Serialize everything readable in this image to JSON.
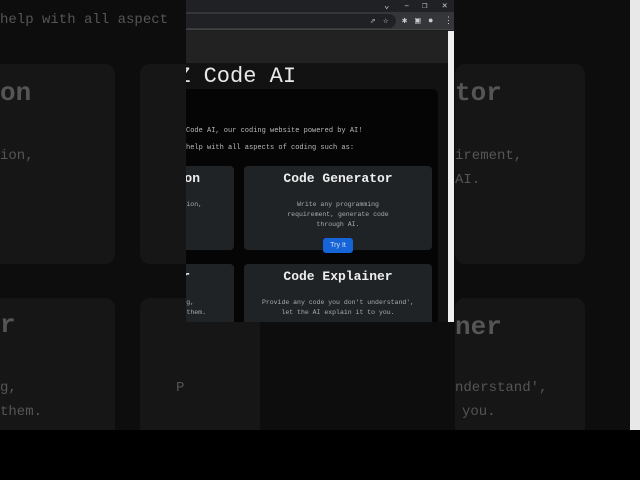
{
  "background": {
    "top_text": "help with all aspect",
    "left": [
      "on",
      "ion,",
      "r",
      "g,",
      "them."
    ],
    "right": [
      "tor",
      "irement,",
      "AI.",
      "ner",
      "nderstand',",
      "you."
    ],
    "right_p": "P"
  },
  "browser": {
    "controls": [
      "chevron-down",
      "minimize",
      "restore",
      "close"
    ]
  },
  "page": {
    "title": "EZ Code AI",
    "intro": "Code AI, our coding website powered by AI!",
    "intro2": "help with all aspects of coding such as:",
    "cards": [
      {
        "title": "Code Generator",
        "desc": "Write any programming requirement, generate code through AI.",
        "button": "Try It"
      },
      {
        "title": "Code Explainer",
        "desc": "Provide any code you don't understand', let the AI explain it to you."
      }
    ],
    "left_cards": [
      {
        "title": "on",
        "desc": "ion,"
      },
      {
        "title": "r",
        "desc": "g,",
        "desc2": "them."
      }
    ]
  }
}
